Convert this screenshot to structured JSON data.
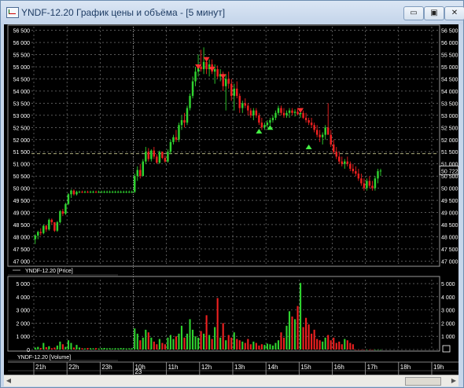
{
  "window": {
    "title": "YNDF-12.20 График цены и объёма - [5 минут]",
    "buttons": {
      "minimize": "▭",
      "maximize": "▣",
      "close": "✕"
    }
  },
  "colors": {
    "up": "#2fd22f",
    "down": "#ee2020",
    "buy_marker": "#44ee44",
    "sell_marker": "#ff3030",
    "grid": "#8c8c8c",
    "text": "#ffffff",
    "current_price_line": "#c8c890"
  },
  "price_panel": {
    "legend": "YNDF-12.20 [Price]",
    "ticks": [
      "56 500",
      "56 000",
      "55 500",
      "55 000",
      "54 500",
      "54 000",
      "53 500",
      "53 000",
      "52 500",
      "52 000",
      "51 500",
      "51 000",
      "50 500",
      "50 000",
      "49 500",
      "49 000",
      "48 500",
      "48 000",
      "47 500",
      "47 000"
    ],
    "last_price_label": "50 722"
  },
  "volume_panel": {
    "legend": "YNDF-12.20 [Volume]",
    "ticks": [
      "5 000",
      "4 000",
      "3 000",
      "2 000",
      "1 000",
      "0"
    ]
  },
  "time_axis": {
    "labels": [
      "21h",
      "22h",
      "23h",
      "10h",
      "11h",
      "12h",
      "13h",
      "14h",
      "15h",
      "16h",
      "17h",
      "18h",
      "19h"
    ],
    "date_label": "23"
  },
  "chart_data": {
    "type": "candlestick",
    "interval": "5 минут",
    "y_price_range": [
      46850,
      56650
    ],
    "y_volume_range": [
      0,
      5300
    ],
    "ohlc": [
      [
        47900,
        48100,
        47700,
        48050
      ],
      [
        48050,
        48250,
        47900,
        48200
      ],
      [
        48200,
        48350,
        48050,
        48150
      ],
      [
        48150,
        48500,
        48100,
        48450
      ],
      [
        48450,
        48500,
        48200,
        48300
      ],
      [
        48300,
        48750,
        48250,
        48700
      ],
      [
        48700,
        48750,
        48500,
        48600
      ],
      [
        48600,
        48550,
        48200,
        48250
      ],
      [
        48250,
        48650,
        48200,
        48600
      ],
      [
        48600,
        49100,
        48550,
        49050
      ],
      [
        49050,
        49150,
        48850,
        48950
      ],
      [
        48950,
        49400,
        48900,
        49350
      ],
      [
        49350,
        49800,
        49300,
        49750
      ],
      [
        49750,
        49950,
        49600,
        49900
      ],
      [
        49900,
        49950,
        49700,
        49750
      ],
      [
        49750,
        49900,
        49700,
        49850
      ],
      [
        49850,
        49900,
        49800,
        49850
      ],
      [
        49850,
        49900,
        49800,
        49820
      ],
      [
        49820,
        49900,
        49800,
        49850
      ],
      [
        49850,
        49900,
        49800,
        49830
      ],
      [
        49830,
        49900,
        49800,
        49850
      ],
      [
        49850,
        49900,
        49800,
        49850
      ],
      [
        49850,
        49900,
        49800,
        49840
      ],
      [
        49840,
        49900,
        49800,
        49850
      ],
      [
        49850,
        49900,
        49800,
        49850
      ],
      [
        49850,
        49900,
        49800,
        49850
      ],
      [
        49850,
        49900,
        49800,
        49850
      ],
      [
        49850,
        49900,
        49800,
        49850
      ],
      [
        49850,
        49900,
        49800,
        49850
      ],
      [
        49850,
        49900,
        49800,
        49850
      ],
      [
        49850,
        49900,
        49800,
        49850
      ],
      [
        49850,
        49900,
        49800,
        49850
      ],
      [
        49850,
        49900,
        49800,
        49850
      ],
      [
        49850,
        49900,
        49800,
        49850
      ],
      [
        49850,
        49900,
        49800,
        49850
      ],
      [
        49850,
        49900,
        49800,
        49850
      ],
      [
        49850,
        50600,
        49800,
        50500
      ],
      [
        50500,
        50900,
        50300,
        50750
      ],
      [
        50750,
        51000,
        50400,
        50500
      ],
      [
        50500,
        51200,
        50500,
        51100
      ],
      [
        51100,
        51700,
        51000,
        51500
      ],
      [
        51500,
        51650,
        51100,
        51200
      ],
      [
        51200,
        51600,
        51100,
        51550
      ],
      [
        51550,
        51700,
        51200,
        51300
      ],
      [
        51300,
        51400,
        51000,
        51050
      ],
      [
        51050,
        51550,
        51000,
        51500
      ],
      [
        51500,
        51500,
        51200,
        51250
      ],
      [
        51250,
        51350,
        51050,
        51100
      ],
      [
        51100,
        51600,
        51050,
        51500
      ],
      [
        51500,
        52000,
        51400,
        51900
      ],
      [
        51900,
        52200,
        51800,
        52100
      ],
      [
        52100,
        52400,
        51900,
        52000
      ],
      [
        52000,
        52700,
        51900,
        52600
      ],
      [
        52600,
        53000,
        52400,
        52800
      ],
      [
        52800,
        53100,
        52500,
        52700
      ],
      [
        52700,
        53400,
        52600,
        53300
      ],
      [
        53300,
        53900,
        53200,
        53800
      ],
      [
        53800,
        54600,
        53700,
        54400
      ],
      [
        54400,
        55000,
        54200,
        54800
      ],
      [
        54800,
        55500,
        54600,
        55000
      ],
      [
        55000,
        55700,
        54800,
        54900
      ],
      [
        54900,
        55800,
        54700,
        55200
      ],
      [
        55200,
        55400,
        54700,
        54900
      ],
      [
        54900,
        55300,
        54600,
        55100
      ],
      [
        55100,
        55300,
        54700,
        54800
      ],
      [
        54800,
        55100,
        54300,
        54900
      ],
      [
        54900,
        55050,
        54500,
        54600
      ],
      [
        54600,
        54900,
        54400,
        54700
      ],
      [
        54700,
        54800,
        54000,
        54200
      ],
      [
        54200,
        54700,
        53200,
        54500
      ],
      [
        54500,
        54800,
        54100,
        54300
      ],
      [
        54300,
        54500,
        53600,
        53800
      ],
      [
        53800,
        54300,
        53200,
        54100
      ],
      [
        54100,
        54400,
        53700,
        53800
      ],
      [
        53800,
        53900,
        53100,
        53300
      ],
      [
        53300,
        53600,
        53100,
        53500
      ],
      [
        53500,
        53700,
        53300,
        53400
      ],
      [
        53400,
        53500,
        53000,
        53200
      ],
      [
        53200,
        53300,
        52900,
        53000
      ],
      [
        53000,
        53300,
        52800,
        53200
      ],
      [
        53200,
        53300,
        52900,
        53000
      ],
      [
        53000,
        53100,
        52600,
        52700
      ],
      [
        52700,
        52900,
        52400,
        52500
      ],
      [
        52500,
        52700,
        52400,
        52600
      ],
      [
        52600,
        52800,
        52500,
        52700
      ],
      [
        52700,
        52900,
        52600,
        52800
      ],
      [
        52800,
        53000,
        52700,
        52900
      ],
      [
        52900,
        53200,
        52800,
        53100
      ],
      [
        53100,
        53400,
        53000,
        53300
      ],
      [
        53300,
        53400,
        53000,
        53100
      ],
      [
        53100,
        53300,
        52900,
        53000
      ],
      [
        53000,
        53200,
        52900,
        53100
      ],
      [
        53100,
        53300,
        52900,
        53200
      ],
      [
        53200,
        53300,
        53000,
        53100
      ],
      [
        53100,
        53250,
        52950,
        53150
      ],
      [
        53150,
        53300,
        53000,
        53050
      ],
      [
        53050,
        53200,
        52900,
        53100
      ],
      [
        53100,
        53200,
        52850,
        52900
      ],
      [
        52900,
        53100,
        52700,
        52800
      ],
      [
        52800,
        52900,
        52600,
        52700
      ],
      [
        52700,
        52900,
        52500,
        52600
      ],
      [
        52600,
        52700,
        52300,
        52400
      ],
      [
        52400,
        52600,
        52100,
        52200
      ],
      [
        52200,
        52400,
        51900,
        52100
      ],
      [
        52100,
        52300,
        51800,
        52200
      ],
      [
        52200,
        52600,
        52000,
        52500
      ],
      [
        52500,
        53500,
        52300,
        52200
      ],
      [
        52200,
        52400,
        51700,
        51800
      ],
      [
        51800,
        52000,
        51400,
        51500
      ],
      [
        51500,
        51700,
        51200,
        51300
      ],
      [
        51300,
        51500,
        51000,
        51100
      ],
      [
        51100,
        51300,
        50900,
        51000
      ],
      [
        51000,
        51200,
        50800,
        51100
      ],
      [
        51100,
        51300,
        50900,
        51000
      ],
      [
        51000,
        51100,
        50700,
        50800
      ],
      [
        50800,
        51000,
        50600,
        50700
      ],
      [
        50700,
        50900,
        50500,
        50600
      ],
      [
        50600,
        50800,
        50300,
        50400
      ],
      [
        50400,
        50600,
        50100,
        50200
      ],
      [
        50200,
        50400,
        49900,
        50000
      ],
      [
        50000,
        50400,
        49900,
        50300
      ],
      [
        50300,
        50500,
        50000,
        50100
      ],
      [
        50100,
        50300,
        49900,
        50000
      ],
      [
        50000,
        50500,
        49900,
        50400
      ],
      [
        50400,
        50800,
        50200,
        50700
      ],
      [
        50700,
        50800,
        50500,
        50722
      ]
    ],
    "volume": [
      150,
      200,
      120,
      500,
      180,
      250,
      100,
      150,
      300,
      600,
      400,
      200,
      700,
      500,
      150,
      350,
      150,
      100,
      80,
      120,
      100,
      90,
      110,
      80,
      100,
      120,
      90,
      100,
      80,
      100,
      90,
      110,
      100,
      80,
      90,
      100,
      1600,
      1200,
      700,
      900,
      1500,
      1300,
      900,
      600,
      400,
      800,
      500,
      400,
      900,
      1100,
      800,
      1000,
      1200,
      1800,
      900,
      1200,
      2300,
      1500,
      1000,
      900,
      1400,
      1200,
      2600,
      1100,
      800,
      1700,
      3900,
      900,
      2000,
      700,
      1100,
      900,
      1300,
      800,
      700,
      600,
      500,
      800,
      400,
      600,
      500,
      300,
      400,
      350,
      450,
      400,
      300,
      500,
      700,
      1300,
      900,
      1800,
      2900,
      2500,
      2300,
      3300,
      5050,
      1700,
      2400,
      1900,
      1200,
      1500,
      800,
      700,
      600,
      900,
      1100,
      700,
      900,
      500,
      600,
      400,
      800,
      700,
      500,
      400
    ],
    "markers": [
      {
        "index": 59,
        "type": "sell",
        "price": 55000
      },
      {
        "index": 62,
        "type": "sell",
        "price": 55300
      },
      {
        "index": 64,
        "type": "sell",
        "price": 54900
      },
      {
        "index": 68,
        "type": "sell",
        "price": 54600
      },
      {
        "index": 81,
        "type": "buy",
        "price": 52350
      },
      {
        "index": 85,
        "type": "buy",
        "price": 52500
      },
      {
        "index": 96,
        "type": "sell",
        "price": 53200
      },
      {
        "index": 99,
        "type": "buy",
        "price": 51700
      }
    ],
    "current_price": 51420,
    "session_break_index": 36,
    "hour_tick_indices": [
      0,
      12,
      24,
      36,
      48,
      60,
      72,
      84,
      96,
      108,
      120,
      132,
      144
    ]
  }
}
